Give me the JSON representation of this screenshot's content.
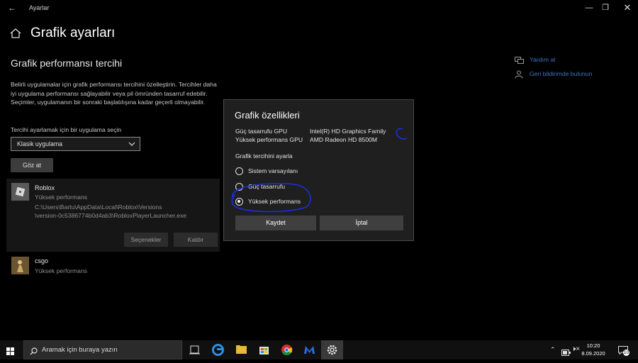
{
  "window": {
    "title": "Ayarlar"
  },
  "page": {
    "title": "Grafik ayarları",
    "section_title": "Grafik performansı tercihi",
    "description": "Belirli uygulamalar için grafik performansı tercihini özelleştirin. Tercihler daha iyi uygulama performansı sağlayabilir veya pil ömründen tasarruf edebilir. Seçimler, uygulamanın bir sonraki başlatılışına kadar geçerli olmayabilir.",
    "select_label": "Tercihi ayarlamak için bir uygulama seçin",
    "select_value": "Klasik uygulama",
    "browse_label": "Göz at"
  },
  "apps": [
    {
      "name": "Roblox",
      "preference": "Yüksek performans",
      "path_line1": "C:\\Users\\Bartu\\AppData\\Local\\Roblox\\Versions",
      "path_line2": "\\version-0c5386774b0d4ab3\\RobloxPlayerLauncher.exe",
      "options_label": "Seçenekler",
      "remove_label": "Kaldır"
    },
    {
      "name": "csgo",
      "preference": "Yüksek performans"
    }
  ],
  "help_links": {
    "get_help": "Yardım al",
    "feedback": "Geri bildirimde bulunun"
  },
  "dialog": {
    "title": "Grafik özellikleri",
    "power_saving_gpu_label": "Güç tasarrufu GPU",
    "power_saving_gpu_value": "Intel(R) HD Graphics Family",
    "high_perf_gpu_label": "Yüksek performans GPU",
    "high_perf_gpu_value": "AMD Radeon HD 8500M",
    "preference_label": "Grafik tercihini ayarla",
    "options": [
      "Sistem varsayılanı",
      "Güç tasarrufu",
      "Yüksek performans"
    ],
    "selected_index": 2,
    "save_label": "Kaydet",
    "cancel_label": "İptal"
  },
  "taskbar": {
    "search_placeholder": "Aramak için buraya yazın",
    "time": "10:20",
    "date": "8.09.2020",
    "notification_count": "10"
  },
  "colors": {
    "accent": "#3a78c0",
    "annotation": "#1e2fd8"
  }
}
